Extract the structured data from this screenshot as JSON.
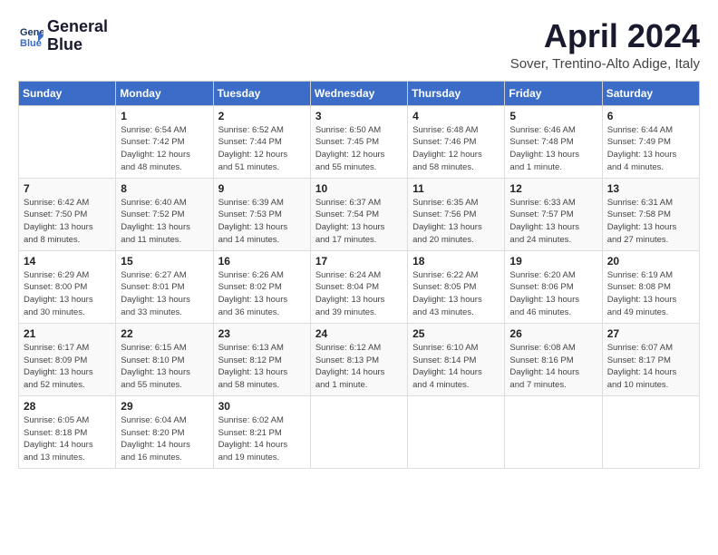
{
  "header": {
    "logo_line1": "General",
    "logo_line2": "Blue",
    "month_title": "April 2024",
    "location": "Sover, Trentino-Alto Adige, Italy"
  },
  "weekdays": [
    "Sunday",
    "Monday",
    "Tuesday",
    "Wednesday",
    "Thursday",
    "Friday",
    "Saturday"
  ],
  "weeks": [
    [
      {
        "day": "",
        "info": ""
      },
      {
        "day": "1",
        "info": "Sunrise: 6:54 AM\nSunset: 7:42 PM\nDaylight: 12 hours\nand 48 minutes."
      },
      {
        "day": "2",
        "info": "Sunrise: 6:52 AM\nSunset: 7:44 PM\nDaylight: 12 hours\nand 51 minutes."
      },
      {
        "day": "3",
        "info": "Sunrise: 6:50 AM\nSunset: 7:45 PM\nDaylight: 12 hours\nand 55 minutes."
      },
      {
        "day": "4",
        "info": "Sunrise: 6:48 AM\nSunset: 7:46 PM\nDaylight: 12 hours\nand 58 minutes."
      },
      {
        "day": "5",
        "info": "Sunrise: 6:46 AM\nSunset: 7:48 PM\nDaylight: 13 hours\nand 1 minute."
      },
      {
        "day": "6",
        "info": "Sunrise: 6:44 AM\nSunset: 7:49 PM\nDaylight: 13 hours\nand 4 minutes."
      }
    ],
    [
      {
        "day": "7",
        "info": "Sunrise: 6:42 AM\nSunset: 7:50 PM\nDaylight: 13 hours\nand 8 minutes."
      },
      {
        "day": "8",
        "info": "Sunrise: 6:40 AM\nSunset: 7:52 PM\nDaylight: 13 hours\nand 11 minutes."
      },
      {
        "day": "9",
        "info": "Sunrise: 6:39 AM\nSunset: 7:53 PM\nDaylight: 13 hours\nand 14 minutes."
      },
      {
        "day": "10",
        "info": "Sunrise: 6:37 AM\nSunset: 7:54 PM\nDaylight: 13 hours\nand 17 minutes."
      },
      {
        "day": "11",
        "info": "Sunrise: 6:35 AM\nSunset: 7:56 PM\nDaylight: 13 hours\nand 20 minutes."
      },
      {
        "day": "12",
        "info": "Sunrise: 6:33 AM\nSunset: 7:57 PM\nDaylight: 13 hours\nand 24 minutes."
      },
      {
        "day": "13",
        "info": "Sunrise: 6:31 AM\nSunset: 7:58 PM\nDaylight: 13 hours\nand 27 minutes."
      }
    ],
    [
      {
        "day": "14",
        "info": "Sunrise: 6:29 AM\nSunset: 8:00 PM\nDaylight: 13 hours\nand 30 minutes."
      },
      {
        "day": "15",
        "info": "Sunrise: 6:27 AM\nSunset: 8:01 PM\nDaylight: 13 hours\nand 33 minutes."
      },
      {
        "day": "16",
        "info": "Sunrise: 6:26 AM\nSunset: 8:02 PM\nDaylight: 13 hours\nand 36 minutes."
      },
      {
        "day": "17",
        "info": "Sunrise: 6:24 AM\nSunset: 8:04 PM\nDaylight: 13 hours\nand 39 minutes."
      },
      {
        "day": "18",
        "info": "Sunrise: 6:22 AM\nSunset: 8:05 PM\nDaylight: 13 hours\nand 43 minutes."
      },
      {
        "day": "19",
        "info": "Sunrise: 6:20 AM\nSunset: 8:06 PM\nDaylight: 13 hours\nand 46 minutes."
      },
      {
        "day": "20",
        "info": "Sunrise: 6:19 AM\nSunset: 8:08 PM\nDaylight: 13 hours\nand 49 minutes."
      }
    ],
    [
      {
        "day": "21",
        "info": "Sunrise: 6:17 AM\nSunset: 8:09 PM\nDaylight: 13 hours\nand 52 minutes."
      },
      {
        "day": "22",
        "info": "Sunrise: 6:15 AM\nSunset: 8:10 PM\nDaylight: 13 hours\nand 55 minutes."
      },
      {
        "day": "23",
        "info": "Sunrise: 6:13 AM\nSunset: 8:12 PM\nDaylight: 13 hours\nand 58 minutes."
      },
      {
        "day": "24",
        "info": "Sunrise: 6:12 AM\nSunset: 8:13 PM\nDaylight: 14 hours\nand 1 minute."
      },
      {
        "day": "25",
        "info": "Sunrise: 6:10 AM\nSunset: 8:14 PM\nDaylight: 14 hours\nand 4 minutes."
      },
      {
        "day": "26",
        "info": "Sunrise: 6:08 AM\nSunset: 8:16 PM\nDaylight: 14 hours\nand 7 minutes."
      },
      {
        "day": "27",
        "info": "Sunrise: 6:07 AM\nSunset: 8:17 PM\nDaylight: 14 hours\nand 10 minutes."
      }
    ],
    [
      {
        "day": "28",
        "info": "Sunrise: 6:05 AM\nSunset: 8:18 PM\nDaylight: 14 hours\nand 13 minutes."
      },
      {
        "day": "29",
        "info": "Sunrise: 6:04 AM\nSunset: 8:20 PM\nDaylight: 14 hours\nand 16 minutes."
      },
      {
        "day": "30",
        "info": "Sunrise: 6:02 AM\nSunset: 8:21 PM\nDaylight: 14 hours\nand 19 minutes."
      },
      {
        "day": "",
        "info": ""
      },
      {
        "day": "",
        "info": ""
      },
      {
        "day": "",
        "info": ""
      },
      {
        "day": "",
        "info": ""
      }
    ]
  ]
}
